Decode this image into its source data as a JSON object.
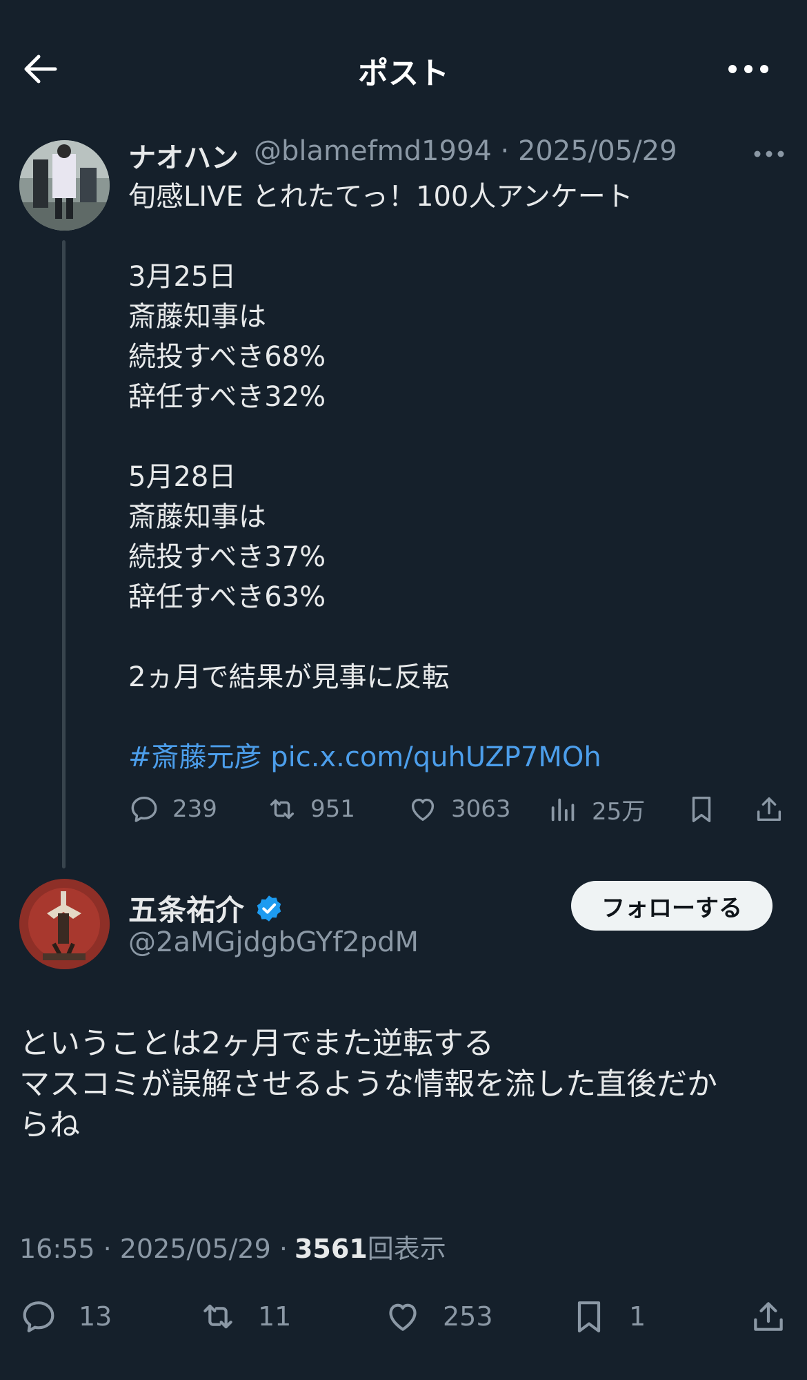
{
  "header": {
    "title": "ポスト"
  },
  "parent_tweet": {
    "author_name": "ナオハン",
    "handle_date": "@blamefmd1994 · 2025/05/29",
    "lines": [
      "旬感LIVE とれたてっ！100人アンケート",
      "",
      "3月25日",
      "斎藤知事は",
      "続投すべき68%",
      "辞任すべき32%",
      "",
      "5月28日",
      "斎藤知事は",
      "続投すべき37%",
      "辞任すべき63%",
      "",
      "2ヵ月で結果が見事に反転",
      ""
    ],
    "hashtag": "#斎藤元彦",
    "pic_link": "pic.x.com/quhUZP7MOh",
    "stats": {
      "replies": "239",
      "reposts": "951",
      "likes": "3063",
      "views": "25万"
    }
  },
  "reply_tweet": {
    "author_name": "五条祐介",
    "handle": "@2aMGjdgbGYf2pdM",
    "follow_label": "フォローする",
    "lines": [
      "ということは2ヶ月でまた逆転する",
      "マスコミが誤解させるような情報を流した直後だか",
      "らね"
    ],
    "timestamp": "16:55 · 2025/05/29 ·",
    "view_count": "3561",
    "view_suffix": "回表示",
    "stats": {
      "replies": "13",
      "reposts": "11",
      "likes": "253",
      "bookmarks": "1"
    }
  },
  "colors": {
    "background": "#15202b",
    "text": "#e7e9ea",
    "muted": "#8b98a5",
    "link": "#4c9eeb",
    "verified": "#1d9bf0"
  }
}
